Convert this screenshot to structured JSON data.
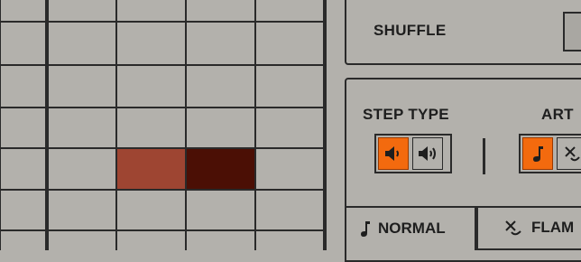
{
  "sequencer": {
    "active_steps": [
      {
        "state": "accent-light",
        "color": "#9e4532"
      },
      {
        "state": "accent-dark",
        "color": "#4b0f05"
      }
    ]
  },
  "shuffle": {
    "label": "SHUFFLE"
  },
  "step_type": {
    "title": "STEP TYPE",
    "options": [
      {
        "icon": "speaker-low-icon",
        "active": true
      },
      {
        "icon": "speaker-high-icon",
        "active": false
      }
    ]
  },
  "articulation": {
    "title": "ART",
    "options": [
      {
        "icon": "note-icon",
        "active": true
      },
      {
        "icon": "flam-icon",
        "active": false
      }
    ]
  },
  "tabs": {
    "normal": {
      "label": "NORMAL",
      "icon": "note-icon"
    },
    "flam": {
      "label": "FLAM",
      "icon": "flam-icon"
    }
  },
  "colors": {
    "accent": "#f36a0e",
    "background": "#b3b1ac",
    "lines": "#2a2a2a"
  }
}
